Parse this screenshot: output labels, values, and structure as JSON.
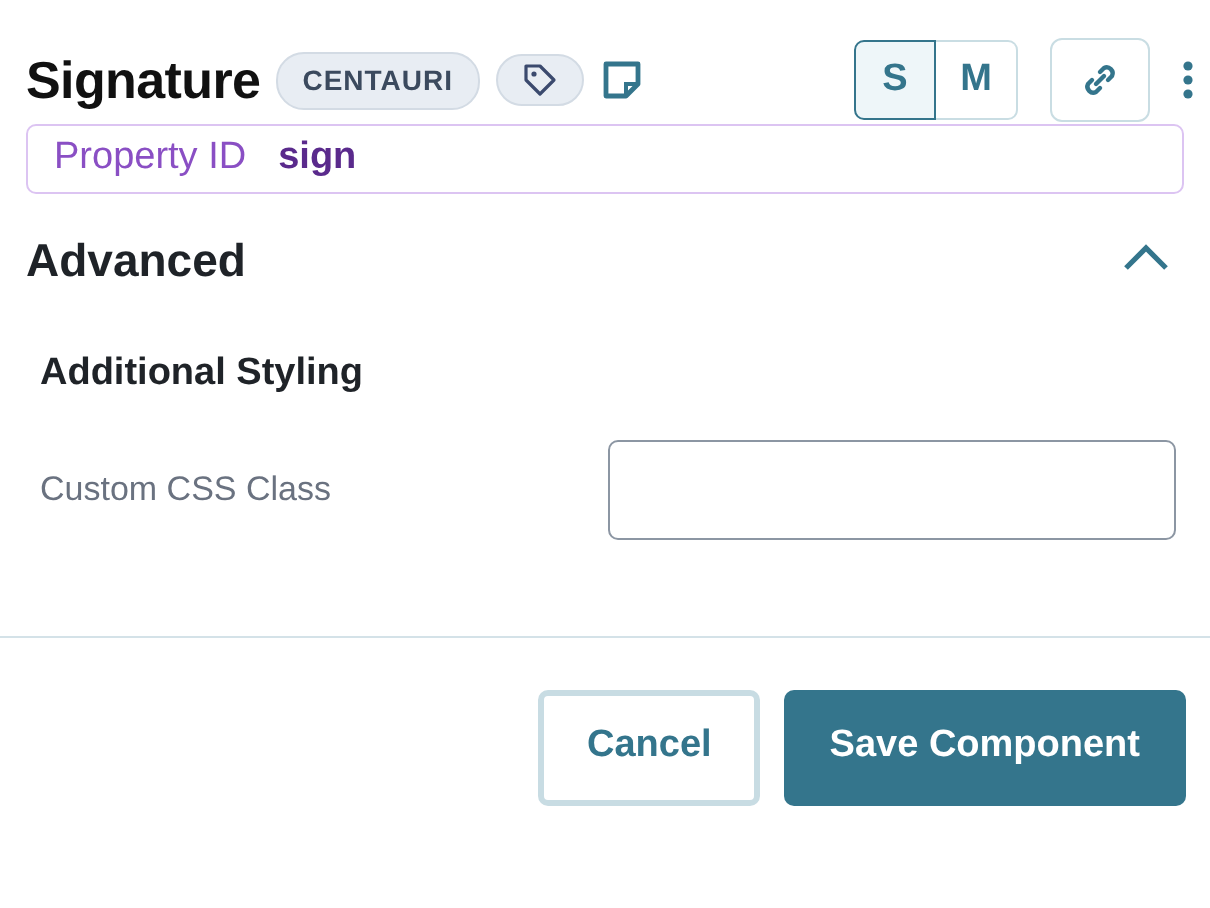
{
  "title": "Signature",
  "tag": "CENTAURI",
  "sizes": [
    {
      "label": "S",
      "selected": true
    },
    {
      "label": "M",
      "selected": false
    }
  ],
  "property": {
    "label": "Property ID",
    "value": "sign"
  },
  "section": {
    "title": "Advanced",
    "expanded": true
  },
  "group": {
    "title": "Additional Styling"
  },
  "field": {
    "label": "Custom CSS Class"
  },
  "buttons": [
    {
      "label": "Cancel",
      "kind": "secondary"
    },
    {
      "label": "Save Component",
      "kind": "primary"
    }
  ]
}
